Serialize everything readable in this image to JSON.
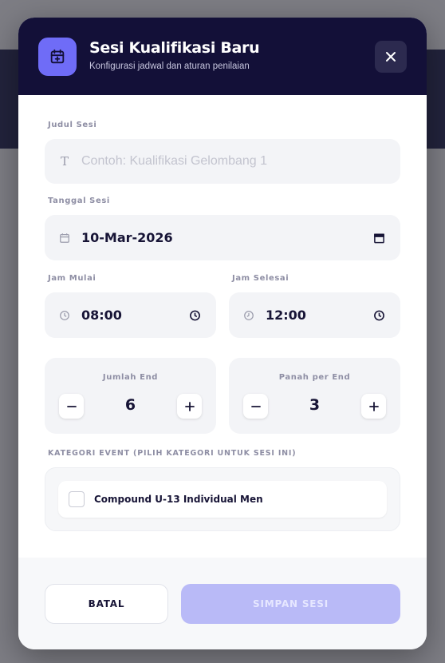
{
  "header": {
    "title": "Sesi Kualifikasi Baru",
    "subtitle": "Konfigurasi jadwal dan aturan penilaian"
  },
  "form": {
    "title_label": "Judul Sesi",
    "title_placeholder": "Contoh: Kualifikasi Gelombang 1",
    "title_value": "",
    "date_label": "Tanggal Sesi",
    "date_value": "10-Mar-2026",
    "start_label": "Jam Mulai",
    "start_value": "08:00",
    "end_label": "Jam Selesai",
    "end_value": "12:00",
    "ends_label": "Jumlah End",
    "ends_value": "6",
    "arrows_label": "Panah per End",
    "arrows_value": "3",
    "category_label": "KATEGORI EVENT (PILIH KATEGORI UNTUK SESI INI)",
    "categories": [
      {
        "name": "Compound U-13 Individual Men",
        "checked": false
      }
    ]
  },
  "footer": {
    "cancel_label": "BATAL",
    "save_label": "SIMPAN SESI"
  },
  "icons": {
    "header": "calendar-plus-icon",
    "close": "close-icon",
    "title_field": "text-icon",
    "date_field": "calendar-icon",
    "time_field": "clock-icon"
  },
  "colors": {
    "header_bg": "#131038",
    "accent": "#6f6cf7",
    "save_disabled": "#b9baf7",
    "text_dark": "#171436"
  }
}
